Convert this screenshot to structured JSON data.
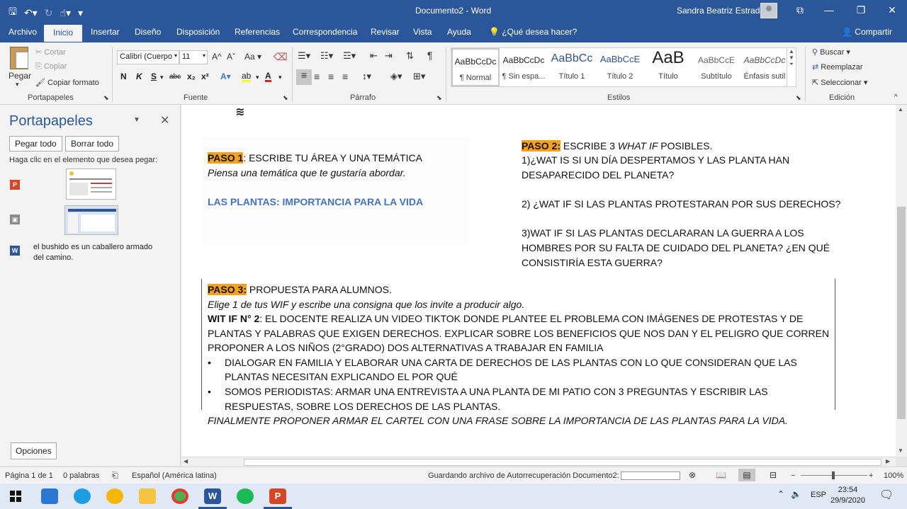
{
  "titlebar": {
    "document_title": "Documento2 - Word",
    "user_name": "Sandra Beatriz Estrada",
    "qat_icons": [
      "save-icon",
      "undo-icon",
      "redo-icon",
      "touch-mode-icon",
      "customize-icon"
    ]
  },
  "tabs": [
    "Archivo",
    "Inicio",
    "Insertar",
    "Diseño",
    "Disposición",
    "Referencias",
    "Correspondencia",
    "Revisar",
    "Vista",
    "Ayuda"
  ],
  "active_tab": "Inicio",
  "tell_me": "¿Qué desea hacer?",
  "share": "Compartir",
  "ribbon": {
    "clipboard": {
      "paste": "Pegar",
      "cut": "Cortar",
      "copy": "Copiar",
      "format_painter": "Copiar formato",
      "label": "Portapapeles"
    },
    "font": {
      "name": "Calibri (Cuerpo",
      "size": "11",
      "label": "Fuente",
      "bold": "N",
      "italic": "K",
      "underline": "S",
      "strike": "abc",
      "sub": "x₂",
      "sup": "x²",
      "grow": "A^",
      "shrink": "Aˇ",
      "case": "Aa"
    },
    "paragraph": {
      "label": "Párrafo"
    },
    "styles": {
      "label": "Estilos",
      "items": [
        {
          "preview": "AaBbCcDc",
          "name": "¶ Normal"
        },
        {
          "preview": "AaBbCcDc",
          "name": "¶ Sin espa..."
        },
        {
          "preview": "AaBbCc",
          "name": "Título 1"
        },
        {
          "preview": "AaBbCcE",
          "name": "Título 2"
        },
        {
          "preview": "AaB",
          "name": "Título"
        },
        {
          "preview": "AaBbCcE",
          "name": "Subtítulo"
        },
        {
          "preview": "AaBbCcDc",
          "name": "Énfasis sutil"
        }
      ]
    },
    "editing": {
      "find": "Buscar",
      "replace": "Reemplazar",
      "select": "Seleccionar",
      "label": "Edición"
    }
  },
  "clipboard_pane": {
    "title": "Portapapeles",
    "paste_all": "Pegar todo",
    "clear_all": "Borrar todo",
    "hint": "Haga clic en el elemento que desea pegar:",
    "text_item": "el bushido es un caballero armado del camino.",
    "options": "Opciones"
  },
  "document": {
    "step1_label": "PASO 1",
    "step1_text": ": ESCRIBE TU ÁREA Y UNA TEMÁTICA",
    "step1_sub": "Piensa una temática que te gustaría abordar.",
    "topic": "LAS PLANTAS: IMPORTANCIA PARA LA VIDA",
    "step2_label": "PASO 2:",
    "step2_text_a": " ESCRIBE 3 ",
    "step2_text_b": "WHAT IF",
    "step2_text_c": " POSIBLES.",
    "step2_lines": [
      "1)¿WAT IS SI UN DÍA DESPERTAMOS Y LAS PLANTA HAN",
      "DESAPARECIDO DEL PLANETA?",
      "2) ¿WAT IF SI LAS PLANTAS PROTESTARAN POR SUS DERECHOS?",
      "3)WAT IF SI LAS PLANTAS DECLARARAN LA GUERRA A LOS",
      "HOMBRES POR SU FALTA DE CUIDADO DEL PLANETA? ¿EN QUÉ",
      "CONSISTIRÍA ESTA GUERRA?"
    ],
    "step3_label": "PASO 3:",
    "step3_text": " PROPUESTA PARA ALUMNOS.",
    "step3_sub": "Elige 1 de tus WIF y escribe una consigna que los invite a producir algo.",
    "wif_label": "WIT IF N° 2",
    "wif_lines": [
      ": EL DOCENTE REALIZA UN VIDEO TIKTOK DONDE PLANTEE EL PROBLEMA CON IMÁGENES DE PROTESTAS Y DE",
      "PLANTAS Y PALABRAS QUE EXIGEN DERECHOS. EXPLICAR SOBRE LOS BENEFICIOS QUE NOS DAN Y EL PELIGRO QUE CORREN",
      "PROPONER A LOS NIÑOS (2°GRADO) DOS ALTERNATIVAS A TRABAJAR EN FAMILIA"
    ],
    "bullet1": [
      "DIALOGAR EN FAMILIA Y ELABORAR UNA CARTA DE DERECHOS DE LAS PLANTAS CON LO QUE CONSIDERAN QUE LAS",
      "PLANTAS NECESITAN EXPLICANDO EL POR QUÉ"
    ],
    "bullet2": [
      " SOMOS PERIODISTAS: ARMAR UNA ENTREVISTA A UNA PLANTA DE MI PATIO CON 3 PREGUNTAS Y ESCRIBIR LAS",
      "RESPUESTAS, SOBRE LOS DERECHOS DE LAS PLANTAS."
    ],
    "final": "FINALMENTE PROPONER ARMAR EL CARTEL CON UNA FRASE SOBRE LA IMPORTANCIA DE LAS PLANTAS PARA LA VIDA."
  },
  "statusbar": {
    "page": "Página 1 de 1",
    "words": "0 palabras",
    "language": "Español (América latina)",
    "autosave": "Guardando archivo de Autorrecuperación Documento2:",
    "zoom": "100%",
    "autosave_progress": 0
  },
  "taskbar": {
    "time": "23:54",
    "date": "29/9/2020",
    "lang": "ESP",
    "apps": [
      "start-icon",
      "mail-icon",
      "edge-icon",
      "norton-icon",
      "file-explorer-icon",
      "chrome-icon",
      "word-icon",
      "spotify-icon",
      "powerpoint-icon"
    ]
  },
  "colors": {
    "word_blue": "#2b579a",
    "highlight": "#f7a21b",
    "topic_blue": "#4472c4"
  }
}
